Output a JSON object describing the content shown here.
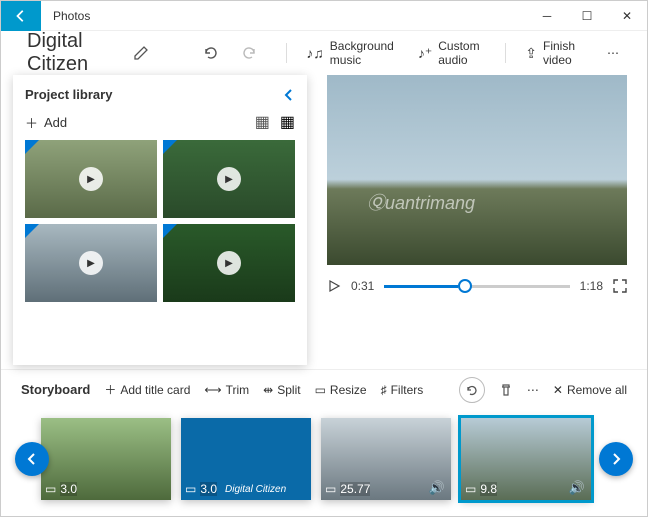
{
  "app": {
    "title": "Photos"
  },
  "project": {
    "title": "Digital Citizen"
  },
  "toolbar": {
    "bg_music": "Background music",
    "custom_audio": "Custom audio",
    "finish": "Finish video"
  },
  "library": {
    "title": "Project library",
    "add": "Add"
  },
  "preview": {
    "current_time": "0:31",
    "total_time": "1:18"
  },
  "storyboard": {
    "title": "Storyboard",
    "add_title": "Add title card",
    "trim": "Trim",
    "split": "Split",
    "resize": "Resize",
    "filters": "Filters",
    "remove_all": "Remove all"
  },
  "clips": [
    {
      "duration": "3.0"
    },
    {
      "duration": "3.0",
      "caption": "Digital Citizen"
    },
    {
      "duration": "25.77"
    },
    {
      "duration": "9.8"
    }
  ],
  "watermark": "Ⓠuantrimang"
}
